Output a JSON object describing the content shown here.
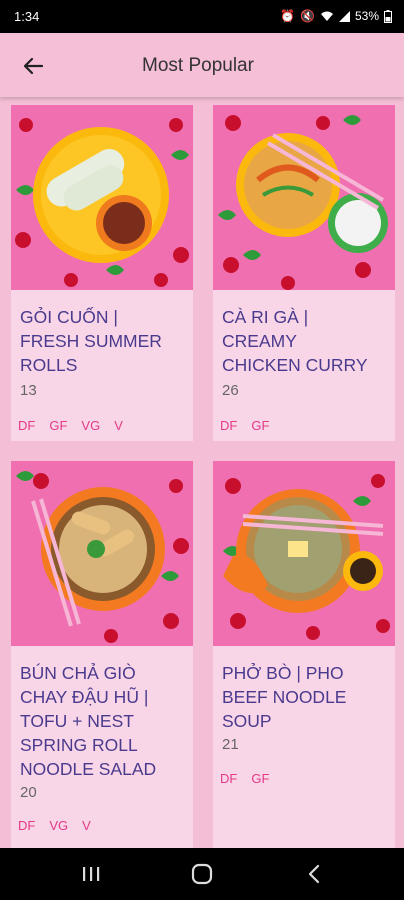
{
  "status_bar": {
    "time": "1:34",
    "battery": "53%",
    "icons": [
      "alarm-icon",
      "mute-icon",
      "wifi-icon",
      "signal-icon",
      "battery-icon"
    ]
  },
  "app_bar": {
    "title": "Most Popular",
    "back_icon": "back-arrow-icon"
  },
  "colors": {
    "background": "#f4bfd6",
    "card": "#f9d6e7",
    "title": "#4a3a8e",
    "tag": "#e23a88"
  },
  "recipes": [
    {
      "title_lines": [
        "GỎI CUỐN |",
        "FRESH SUMMER",
        "ROLLS"
      ],
      "count": "13",
      "tags": [
        "DF",
        "GF",
        "VG",
        "V"
      ]
    },
    {
      "title_lines": [
        "CÀ RI GÀ  |",
        "CREAMY",
        "CHICKEN CURRY"
      ],
      "count": "26",
      "tags": [
        "DF",
        "GF"
      ]
    },
    {
      "title_lines": [
        "BÚN CHẢ GIÒ",
        "CHAY ĐẬU HŨ  |",
        "TOFU + NEST",
        "SPRING ROLL",
        "NOODLE SALAD"
      ],
      "count": "20",
      "tags": [
        "DF",
        "VG",
        "V"
      ]
    },
    {
      "title_lines": [
        "PHỞ BÒ | PHO",
        "BEEF NOODLE",
        "SOUP"
      ],
      "count": "21",
      "tags": [
        "DF",
        "GF"
      ]
    }
  ],
  "nav_bar": {
    "icons": [
      "recent-apps-icon",
      "home-icon",
      "back-icon"
    ]
  }
}
